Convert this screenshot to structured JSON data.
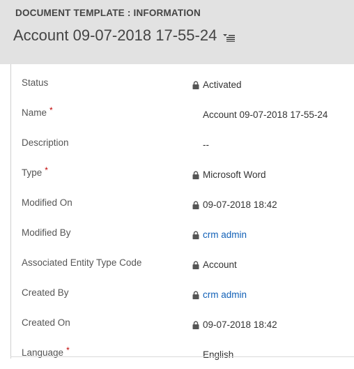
{
  "header": {
    "entity_label": "DOCUMENT TEMPLATE : INFORMATION",
    "record_title": "Account 09-07-2018 17-55-24"
  },
  "colors": {
    "header_bg": "#e2e2e2",
    "link": "#1160b7",
    "required": "#c00000"
  },
  "fields": [
    {
      "label": "Status",
      "required": false,
      "locked": true,
      "value": "Activated",
      "link": false
    },
    {
      "label": "Name",
      "required": true,
      "locked": false,
      "value": "Account 09-07-2018 17-55-24",
      "link": false
    },
    {
      "label": "Description",
      "required": false,
      "locked": false,
      "value": "--",
      "link": false
    },
    {
      "label": "Type",
      "required": true,
      "locked": true,
      "value": "Microsoft Word",
      "link": false
    },
    {
      "label": "Modified On",
      "required": false,
      "locked": true,
      "value": "09-07-2018   18:42",
      "link": false
    },
    {
      "label": "Modified By",
      "required": false,
      "locked": true,
      "value": "crm admin",
      "link": true
    },
    {
      "label": "Associated Entity Type Code",
      "required": false,
      "locked": true,
      "value": "Account",
      "link": false
    },
    {
      "label": "Created By",
      "required": false,
      "locked": true,
      "value": "crm admin",
      "link": true
    },
    {
      "label": "Created On",
      "required": false,
      "locked": true,
      "value": "09-07-2018   18:42",
      "link": false
    },
    {
      "label": "Language",
      "required": true,
      "locked": false,
      "value": "English",
      "link": false
    }
  ],
  "required_marker": "*"
}
